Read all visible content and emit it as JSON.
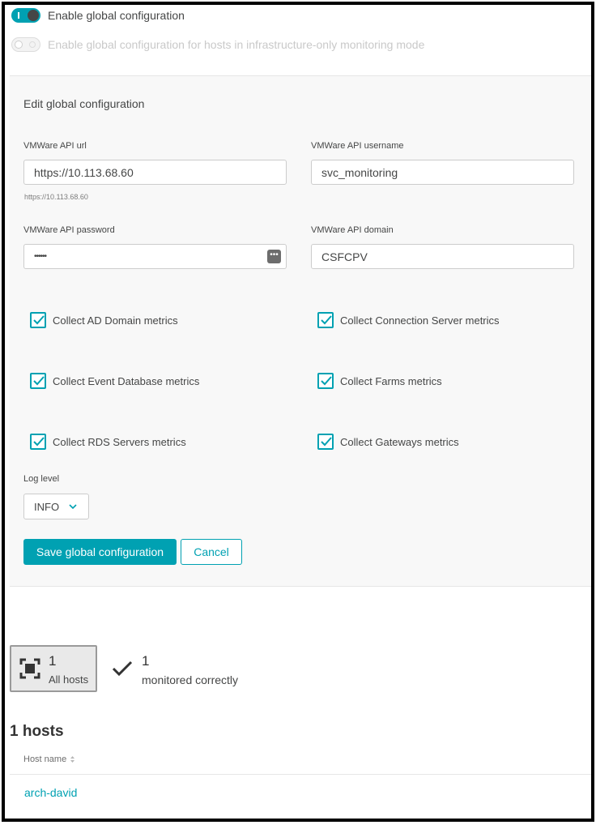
{
  "toggles": {
    "global": {
      "label": "Enable global configuration",
      "on": true
    },
    "infra": {
      "label": "Enable global configuration for hosts in infrastructure-only monitoring mode",
      "on": false
    }
  },
  "panel": {
    "title": "Edit global configuration",
    "fields": {
      "api_url": {
        "label": "VMWare API url",
        "value": "https://10.113.68.60",
        "hint": "https://10.113.68.60"
      },
      "api_username": {
        "label": "VMWare API username",
        "value": "svc_monitoring"
      },
      "api_password": {
        "label": "VMWare API password",
        "value": "••••••",
        "reveal_icon": "more-dots-icon"
      },
      "api_domain": {
        "label": "VMWare API domain",
        "value": "CSFCPV"
      }
    },
    "checkboxes": [
      {
        "label": "Collect AD Domain metrics",
        "checked": true
      },
      {
        "label": "Collect Connection Server metrics",
        "checked": true
      },
      {
        "label": "Collect Event Database metrics",
        "checked": true
      },
      {
        "label": "Collect Farms metrics",
        "checked": true
      },
      {
        "label": "Collect RDS Servers metrics",
        "checked": true
      },
      {
        "label": "Collect Gateways metrics",
        "checked": true
      }
    ],
    "log_level": {
      "label": "Log level",
      "value": "INFO"
    },
    "save_label": "Save global configuration",
    "cancel_label": "Cancel"
  },
  "stats": {
    "all_hosts": {
      "count": "1",
      "label": "All hosts"
    },
    "monitored": {
      "count": "1",
      "label": "monitored correctly"
    }
  },
  "hosts": {
    "title": "1 hosts",
    "column_header": "Host name",
    "rows": [
      {
        "name": "arch-david"
      }
    ]
  },
  "colors": {
    "accent": "#00a1b2",
    "text": "#454646"
  }
}
